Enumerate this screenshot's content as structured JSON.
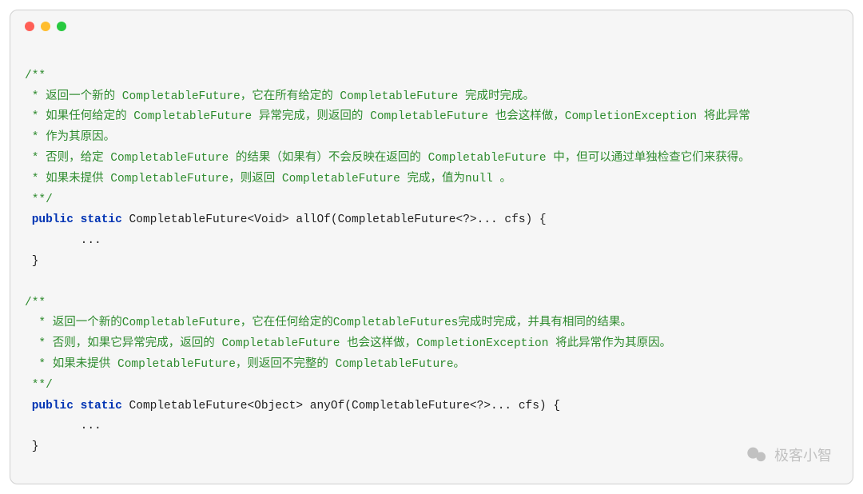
{
  "comment1": {
    "l1": "/**",
    "l2": " * 返回一个新的 CompletableFuture，它在所有给定的 CompletableFuture 完成时完成。",
    "l3": " * 如果任何给定的 CompletableFuture 异常完成，则返回的 CompletableFuture 也会这样做，CompletionException 将此异常",
    "l4": " * 作为其原因。",
    "l5": " * 否则，给定 CompletableFuture 的结果（如果有）不会反映在返回的 CompletableFuture 中，但可以通过单独检查它们来获得。",
    "l6": " * 如果未提供 CompletableFuture，则返回 CompletableFuture 完成，值为null 。",
    "l7": " **/"
  },
  "sig1": {
    "kw1": "public",
    "kw2": "static",
    "rest": " CompletableFuture<Void> allOf(CompletableFuture<?>... cfs) {"
  },
  "body1": "        ...",
  "close1": " }",
  "blank": "",
  "comment2": {
    "l1": "/**",
    "l2": "  * 返回一个新的CompletableFuture，它在任何给定的CompletableFutures完成时完成，并具有相同的结果。",
    "l3": "  * 否则，如果它异常完成，返回的 CompletableFuture 也会这样做，CompletionException 将此异常作为其原因。",
    "l4": "  * 如果未提供 CompletableFuture，则返回不完整的 CompletableFuture。",
    "l5": " **/"
  },
  "sig2": {
    "kw1": "public",
    "kw2": "static",
    "rest": " CompletableFuture<Object> anyOf(CompletableFuture<?>... cfs) {"
  },
  "body2": "        ...",
  "close2": " }",
  "watermark": "极客小智"
}
